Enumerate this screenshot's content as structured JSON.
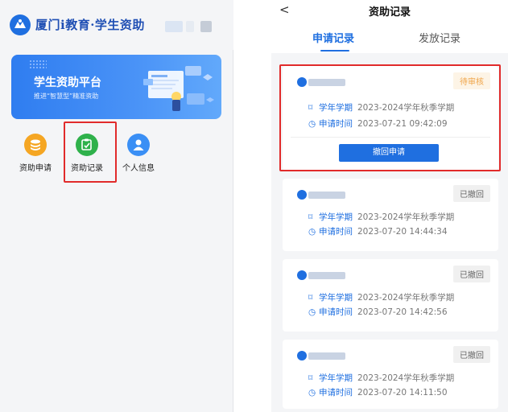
{
  "left": {
    "brand": {
      "name": "厦门i教育·学生资助"
    },
    "banner": {
      "title": "学生资助平台",
      "subtitle": "推进“智慧型”精准资助"
    },
    "menu": [
      {
        "label": "资助申请",
        "icon": "coin-stack-icon",
        "color": "#f5a623"
      },
      {
        "label": "资助记录",
        "icon": "clipboard-edit-icon",
        "color": "#2fb14b"
      },
      {
        "label": "个人信息",
        "icon": "user-icon",
        "color": "#3a8ff5"
      }
    ]
  },
  "right": {
    "nav": {
      "title": "资助记录",
      "back": "<"
    },
    "tabs": [
      {
        "label": "申请记录",
        "active": true
      },
      {
        "label": "发放记录",
        "active": false
      }
    ],
    "field_labels": {
      "term": "学年学期",
      "time": "申请时间"
    },
    "records": [
      {
        "status": "待审核",
        "term": "2023-2024学年秋季学期",
        "time": "2023-07-21 09:42:09",
        "action": "撤回申请"
      },
      {
        "status": "已撤回",
        "term": "2023-2024学年秋季学期",
        "time": "2023-07-20 14:44:34"
      },
      {
        "status": "已撤回",
        "term": "2023-2024学年秋季学期",
        "time": "2023-07-20 14:42:56"
      },
      {
        "status": "已撤回",
        "term": "2023-2024学年秋季学期",
        "time": "2023-07-20 14:11:50"
      }
    ]
  },
  "colors": {
    "accent": "#1f6fe0",
    "highlight": "#e12b2b",
    "pending": "#f0a54a"
  }
}
